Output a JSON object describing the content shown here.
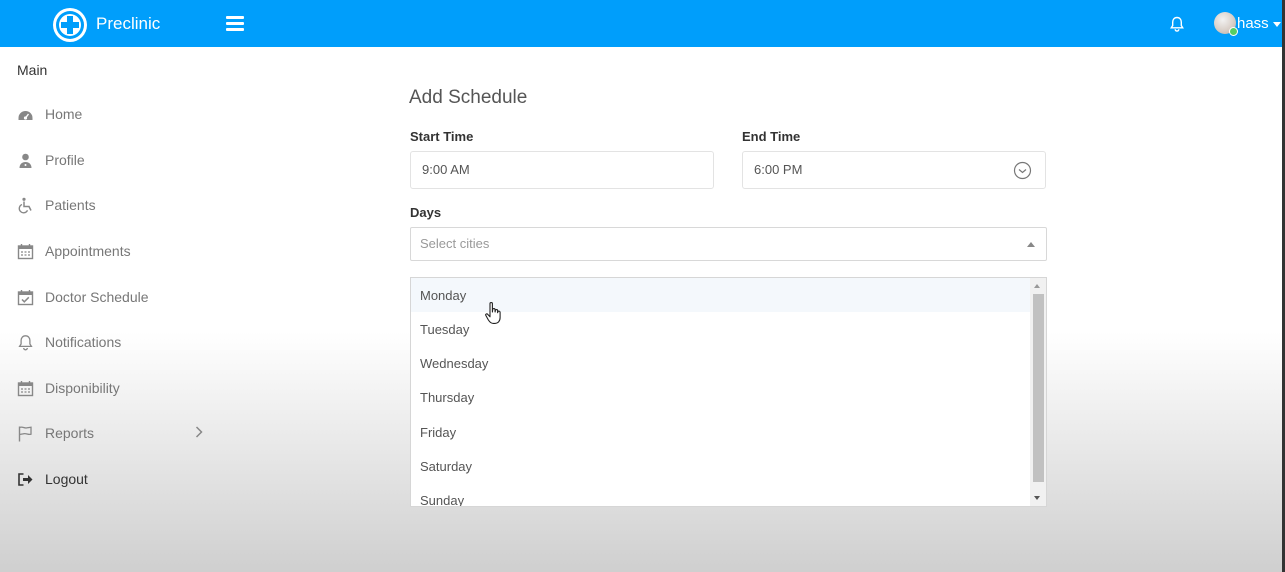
{
  "app": {
    "name": "Preclinic"
  },
  "header": {
    "username": "hass",
    "logo_icon": "plus-circle",
    "menu_icon": "hamburger",
    "bell_icon": "bell"
  },
  "sidebar": {
    "section_label": "Main",
    "items": [
      {
        "label": "Home",
        "icon": "dashboard"
      },
      {
        "label": "Profile",
        "icon": "user-md"
      },
      {
        "label": "Patients",
        "icon": "wheelchair"
      },
      {
        "label": "Appointments",
        "icon": "calendar"
      },
      {
        "label": "Doctor Schedule",
        "icon": "calendar-check"
      },
      {
        "label": "Notifications",
        "icon": "bell"
      },
      {
        "label": "Disponibility",
        "icon": "calendar"
      },
      {
        "label": "Reports",
        "icon": "flag"
      },
      {
        "label": "Logout",
        "icon": "sign-out"
      }
    ]
  },
  "form": {
    "title": "Add Schedule",
    "start_time": {
      "label": "Start Time",
      "value": "9:00 AM"
    },
    "end_time": {
      "label": "End Time",
      "value": "6:00 PM"
    },
    "days": {
      "label": "Days",
      "placeholder": "Select cities",
      "options": [
        "Monday",
        "Tuesday",
        "Wednesday",
        "Thursday",
        "Friday",
        "Saturday",
        "Sunday"
      ],
      "hovered": "Monday"
    }
  },
  "colors": {
    "primary": "#009efb",
    "online": "#55ce63"
  }
}
